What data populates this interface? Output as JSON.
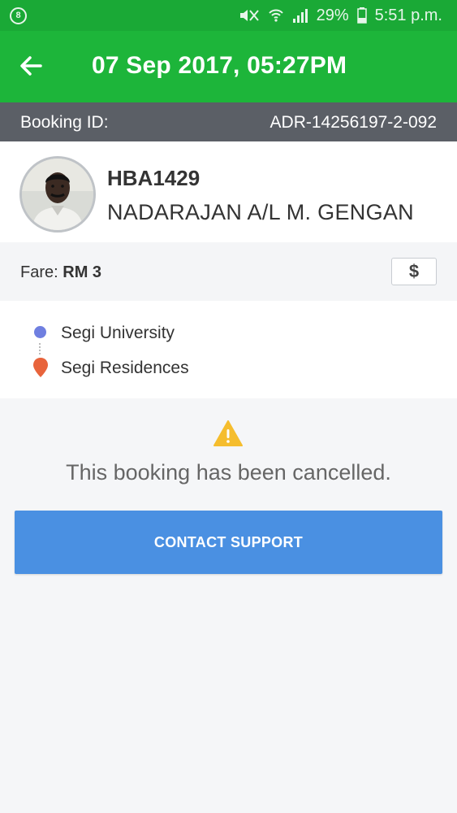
{
  "status_bar": {
    "battery": "29%",
    "time": "5:51 p.m.",
    "icons": [
      "notification-icon",
      "mute-icon",
      "wifi-icon",
      "signal-icon",
      "battery-icon"
    ]
  },
  "header": {
    "title": "07 Sep 2017, 05:27PM",
    "back_icon": "arrow-left-icon"
  },
  "booking": {
    "label": "Booking ID:",
    "id": "ADR-14256197-2-092"
  },
  "driver": {
    "plate": "HBA1429",
    "name": "NADARAJAN A/L M. GENGAN"
  },
  "fare": {
    "label": "Fare:",
    "amount": "RM 3",
    "payment_icon": "$"
  },
  "route": {
    "pickup": "Segi University",
    "dropoff": "Segi Residences"
  },
  "notice": {
    "icon": "warning-icon",
    "message": "This booking has been cancelled."
  },
  "actions": {
    "contact_support": "CONTACT SUPPORT"
  },
  "colors": {
    "status_bar": "#1aa936",
    "app_bar": "#1db53a",
    "booking_bar": "#5b5f66",
    "button": "#4a90e2",
    "pickup_dot": "#6f7fe0",
    "dropoff_pin": "#e8643c",
    "warning": "#f5bd2e"
  }
}
